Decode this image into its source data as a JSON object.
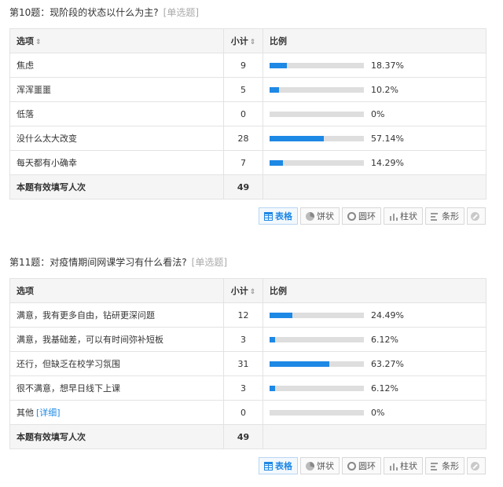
{
  "questions": [
    {
      "title": "第10题：现阶段的状态以什么为主?",
      "type": "[单选题]",
      "headers": {
        "option": "选项",
        "count": "小计",
        "ratio": "比例"
      },
      "rows": [
        {
          "option": "焦虑",
          "count": "9",
          "percent": "18.37%",
          "ratio": 0.1837
        },
        {
          "option": "浑浑噩噩",
          "count": "5",
          "percent": "10.2%",
          "ratio": 0.102
        },
        {
          "option": "低落",
          "count": "0",
          "percent": "0%",
          "ratio": 0
        },
        {
          "option": "没什么太大改变",
          "count": "28",
          "percent": "57.14%",
          "ratio": 0.5714
        },
        {
          "option": "每天都有小确幸",
          "count": "7",
          "percent": "14.29%",
          "ratio": 0.1429
        }
      ],
      "total": {
        "label": "本题有效填写人次",
        "count": "49"
      }
    },
    {
      "title": "第11题：对疫情期间网课学习有什么看法?",
      "type": "[单选题]",
      "headers": {
        "option": "选项",
        "count": "小计",
        "ratio": "比例"
      },
      "rows": [
        {
          "option": "满意，我有更多自由，钻研更深问题",
          "count": "12",
          "percent": "24.49%",
          "ratio": 0.2449
        },
        {
          "option": "满意，我基础差，可以有时间弥补短板",
          "count": "3",
          "percent": "6.12%",
          "ratio": 0.0612
        },
        {
          "option": "还行，但缺乏在校学习氛围",
          "count": "31",
          "percent": "63.27%",
          "ratio": 0.6327
        },
        {
          "option": "很不满意，想早日线下上课",
          "count": "3",
          "percent": "6.12%",
          "ratio": 0.0612
        },
        {
          "option": "其他",
          "detail": "[详细]",
          "count": "0",
          "percent": "0%",
          "ratio": 0
        }
      ],
      "total": {
        "label": "本题有效填写人次",
        "count": "49"
      }
    }
  ],
  "toolbar": {
    "table": "表格",
    "pie": "饼状",
    "ring": "圆环",
    "column": "柱状",
    "bar": "条形",
    "active": "table",
    "icons": {
      "table": "table-icon",
      "pie": "pie-chart-icon",
      "ring": "donut-chart-icon",
      "column": "column-chart-icon",
      "bar": "bar-chart-icon",
      "hide": "disable-icon"
    }
  },
  "colors": {
    "bar_fill": "#1e88e5",
    "bar_track": "#dedede",
    "link": "#1e88e5",
    "header_bg": "#f5f5f5"
  }
}
